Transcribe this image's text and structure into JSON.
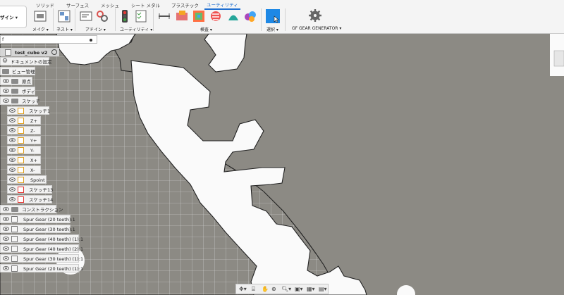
{
  "toolbar": {
    "tabs": [
      "ソリッド",
      "サーフェス",
      "メッシュ",
      "シート メタル",
      "プラスチック",
      "ユーティリティ"
    ],
    "active_tab": 5,
    "groups": {
      "design": "ザイン ▾",
      "make": "メイク ▾",
      "nest": "ネスト ▾",
      "addin": "アドイン ▾",
      "utility": "ユーティリティ ▾",
      "inspect": "検査 ▾",
      "select": "選択 ▾",
      "gear": "GF GEAR GENERATOR ▾"
    },
    "colors": {
      "accent": "#1f6fd1",
      "select_icon": "#1e88e5"
    }
  },
  "browser": {
    "search_value": "f",
    "root": "test_cube v2",
    "items": [
      {
        "label": "ドキュメントの設定",
        "type": "gear",
        "indent": 0
      },
      {
        "label": "ビュー管理",
        "type": "folder",
        "indent": 0
      },
      {
        "label": "原点",
        "type": "folder",
        "indent": 1
      },
      {
        "label": "ボディ",
        "type": "folder",
        "indent": 1
      },
      {
        "label": "スケッチ",
        "type": "folder",
        "indent": 1
      },
      {
        "label": "スケッチ1",
        "type": "sketch",
        "indent": 2
      },
      {
        "label": "Z+",
        "type": "sketch",
        "indent": 2
      },
      {
        "label": "Z-",
        "type": "sketch",
        "indent": 2
      },
      {
        "label": "Y+",
        "type": "sketch",
        "indent": 2
      },
      {
        "label": "Y-",
        "type": "sketch",
        "indent": 2
      },
      {
        "label": "X+",
        "type": "sketch",
        "indent": 2
      },
      {
        "label": "X-",
        "type": "sketch",
        "indent": 2
      },
      {
        "label": "Spoint",
        "type": "sketch",
        "indent": 2
      },
      {
        "label": "スケッチ13",
        "type": "sketch",
        "indent": 2
      },
      {
        "label": "スケッチ14",
        "type": "sketch",
        "indent": 2
      },
      {
        "label": "コンストラクション",
        "type": "folder",
        "indent": 0
      },
      {
        "label": "Spur Gear (20 teeth):1",
        "type": "part",
        "indent": 0
      },
      {
        "label": "Spur Gear (30 teeth):1",
        "type": "part",
        "indent": 0
      },
      {
        "label": "Spur Gear (40 teeth) (1):1",
        "type": "part",
        "indent": 0
      },
      {
        "label": "Spur Gear (40 teeth) (2):1",
        "type": "part",
        "indent": 0
      },
      {
        "label": "Spur Gear (30 teeth) (1):1",
        "type": "part",
        "indent": 0
      },
      {
        "label": "Spur Gear (20 teeth) (1):1",
        "type": "part",
        "indent": 0
      }
    ]
  },
  "navbar": {
    "icons": [
      "orbit-icon",
      "look-at-icon",
      "pan-icon",
      "zoom-icon",
      "fit-icon",
      "display-settings-icon",
      "grid-icon",
      "viewports-icon"
    ]
  }
}
